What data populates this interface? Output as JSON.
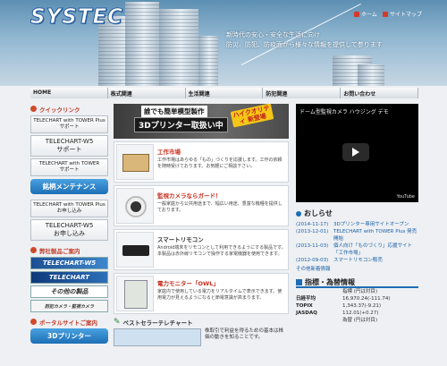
{
  "header": {
    "logo": "SYSTEC",
    "links": [
      "ホーム",
      "サイトマップ"
    ],
    "tagline": [
      "新時代の安心・安全な生活に向け",
      "防災、防犯、防疫面から様々な情報を提供して参ります"
    ]
  },
  "nav": [
    "HOME",
    "株式関連",
    "生活関連",
    "防犯関連",
    "お問い合わせ"
  ],
  "left": {
    "quicklink_title": "クイックリンク",
    "buttons_support": [
      [
        "TELECHART with TOWER Plus",
        "サポート"
      ],
      [
        "TELECHART-W5",
        "サポート"
      ],
      [
        "TELECHART with TOWER",
        "サポート"
      ]
    ],
    "maintenance_banner": "銘柄メンテナンス",
    "buttons_inquiry": [
      [
        "TELECHART with TOWER Plus",
        "お申し込み"
      ],
      [
        "TELECHART-W5",
        "お申し込み"
      ]
    ],
    "products_title": "弊社製品ご案内",
    "product_images": [
      "TELECHART-W5",
      "TELECHART",
      "その他の製品",
      "防犯カメラ・監視カメラ"
    ],
    "portal_title": "ポータルサイトご案内",
    "portal_banner": "3Dプリンター"
  },
  "center": {
    "promo": {
      "line1": "誰でも簡単模型製作",
      "line2": "3Dプリンター取扱い中",
      "tag": "ハイクオリティ 新登場"
    },
    "cards": [
      {
        "title": "工作市場",
        "text": "工作市場はあらゆる「もの」づくりを応援します。工作の依頼を随時受けております。お気軽にご相談下さい。"
      },
      {
        "title": "監視カメラならガード！",
        "text": "一般家庭から公共用途まで、幅広い用途、豊富な機種を提供しております。"
      },
      {
        "title": "スマートリモコン",
        "text": "Android端末をリモコンとして利用できるようにする製品です。本製品は赤外線リモコンで操作する家電機器を使用できます。"
      },
      {
        "title": "電力モニター「OWL」",
        "text": "家庭内で使用している電力をリアルタイムで表示できます。使用電力が見えるようになると節電意識が高まります。"
      }
    ],
    "bestseller_title": "ベストセラーテレチャート",
    "bestseller_text": [
      "株取引で利益を得るための基本は株",
      "価の動きを知ることです。"
    ]
  },
  "right": {
    "video_title": "ドーム型監視カメラ ハウジング デモ",
    "video_brand": "YouTube",
    "news_title": "おしらせ",
    "news": [
      {
        "date": "(2014-11-17)",
        "text": "3Dプリンター専用サイトオープン"
      },
      {
        "date": "(2013-12-01)",
        "text": "TELECHART with TOWER Plus 発売開始"
      },
      {
        "date": "(2013-11-03)",
        "text": "個人向け「ものづくり」応援サイト「工作市場」"
      },
      {
        "date": "(2012-09-03)",
        "text": "スマートリモコン販売"
      }
    ],
    "news_more": "その他新着情報",
    "market_title": "指標・為替情報",
    "market_header": "指標 (円は対目)",
    "market": [
      {
        "k": "日経平均",
        "v": "16,970.24(-111.74)"
      },
      {
        "k": "TOPIX",
        "v": "1,343.37(-9.21)"
      },
      {
        "k": "JASDAQ",
        "v": "112.01(+0.27)"
      },
      {
        "k": "",
        "v": "為替   (円は対目)"
      }
    ]
  }
}
